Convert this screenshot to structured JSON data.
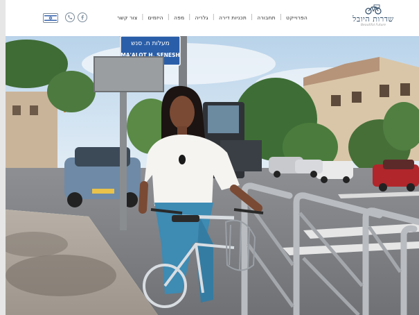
{
  "header": {
    "logo": {
      "title": "שדרות היובל",
      "subtitle": "Beautiful Future"
    },
    "nav": [
      {
        "label": "הפרוייקט"
      },
      {
        "label": "תחבורה"
      },
      {
        "label": "תכניות דירה"
      },
      {
        "label": "גלריה"
      },
      {
        "label": "מפה"
      },
      {
        "label": "היזמים"
      },
      {
        "label": "צור קשר"
      }
    ],
    "icons": [
      "facebook-icon",
      "phone-icon",
      "israel-flag-icon"
    ]
  },
  "hero": {
    "street_sign_hebrew": "מעלות ח. סנש",
    "street_sign_english": "MA'ALOT H. SENESH"
  },
  "colors": {
    "brand": "#2d4a66",
    "sign_blue": "#2a5ea8"
  }
}
